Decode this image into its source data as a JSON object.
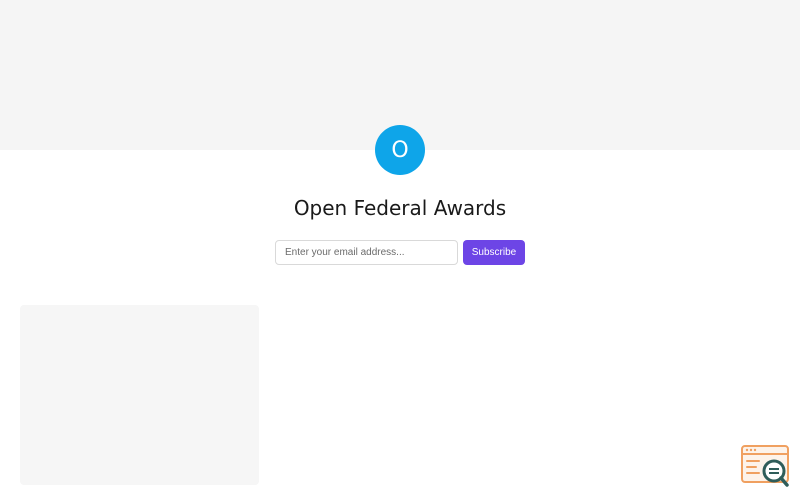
{
  "profile": {
    "avatar_initial": "O",
    "title": "Open Federal Awards"
  },
  "subscribe": {
    "email_placeholder": "Enter your email address...",
    "button_label": "Subscribe"
  },
  "colors": {
    "avatar": "#0ea5e9",
    "subscribe_button": "#6d45e6",
    "cover": "#f5f5f5",
    "widget_accent": "#f0a060"
  },
  "icons": {
    "widget": "search-browser-icon"
  }
}
